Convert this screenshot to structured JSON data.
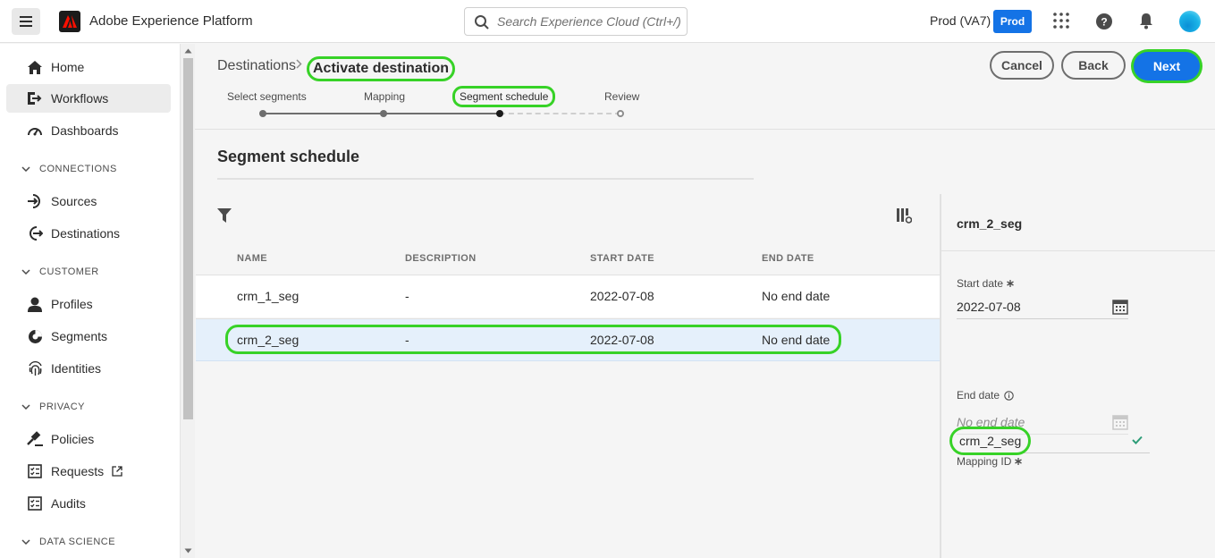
{
  "app": {
    "title": "Adobe Experience Platform"
  },
  "search": {
    "placeholder": "Search Experience Cloud (Ctrl+/)"
  },
  "topbar": {
    "org": "Prod (VA7)",
    "sandbox_badge": "Prod",
    "icons": [
      "apps-grid-icon",
      "help-icon",
      "bell-icon",
      "avatar"
    ]
  },
  "sidebar": {
    "items": [
      {
        "label": "Home",
        "icon": "home-icon"
      },
      {
        "label": "Workflows",
        "icon": "workflows-icon",
        "active": true
      },
      {
        "label": "Dashboards",
        "icon": "dashboard-icon"
      }
    ],
    "connections": {
      "title": "CONNECTIONS",
      "items": [
        {
          "label": "Sources"
        },
        {
          "label": "Destinations"
        }
      ]
    },
    "customer": {
      "title": "CUSTOMER",
      "items": [
        {
          "label": "Profiles"
        },
        {
          "label": "Segments"
        },
        {
          "label": "Identities"
        }
      ]
    },
    "privacy": {
      "title": "PRIVACY",
      "items": [
        {
          "label": "Policies"
        },
        {
          "label": "Requests"
        },
        {
          "label": "Audits"
        }
      ]
    },
    "data_science": {
      "title": "DATA SCIENCE"
    }
  },
  "breadcrumb": {
    "parent": "Destinations",
    "current": "Activate destination"
  },
  "actions": {
    "cancel": "Cancel",
    "back": "Back",
    "next": "Next"
  },
  "steps": [
    {
      "label": "Select segments",
      "state": "done"
    },
    {
      "label": "Mapping",
      "state": "done"
    },
    {
      "label": "Segment schedule",
      "state": "current"
    },
    {
      "label": "Review",
      "state": "todo"
    }
  ],
  "section": {
    "title": "Segment schedule"
  },
  "table": {
    "columns": [
      "NAME",
      "DESCRIPTION",
      "START DATE",
      "END DATE"
    ],
    "rows": [
      {
        "name": "crm_1_seg",
        "description": "-",
        "start_date": "2022-07-08",
        "end_date": "No end date"
      },
      {
        "name": "crm_2_seg",
        "description": "-",
        "start_date": "2022-07-08",
        "end_date": "No end date",
        "selected": true
      }
    ]
  },
  "panel": {
    "title": "crm_2_seg",
    "start_date_label": "Start date",
    "start_date_value": "2022-07-08",
    "end_date_label": "End date",
    "end_date_placeholder": "No end date",
    "mapping_id_label": "Mapping ID",
    "mapping_id_value": "crm_2_seg"
  },
  "colors": {
    "accent": "#1473e6",
    "highlight": "#37d227",
    "selected_row": "#e5f0fb"
  }
}
